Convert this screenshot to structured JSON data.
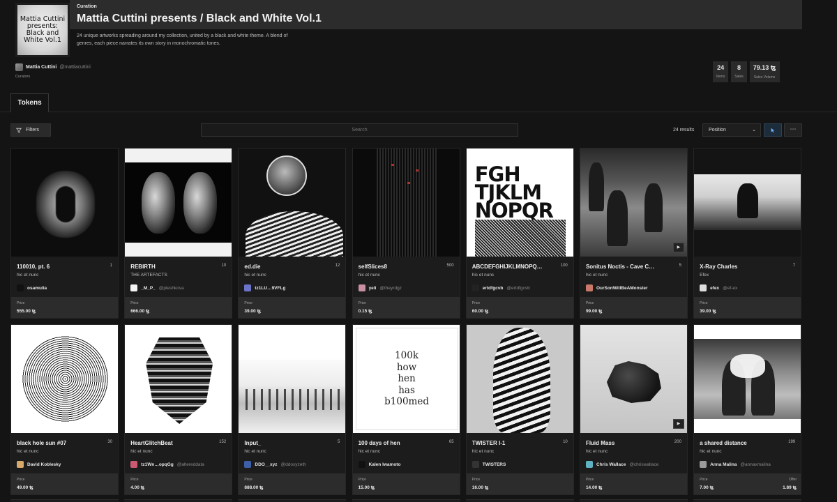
{
  "collection": {
    "eyebrow": "Curation",
    "title": "Mattia Cuttini presents / Black and White Vol.1",
    "description": "24 unique artworks spreading around my collection, united by a black and white theme.  A blend of genres, each piece narrates its own story in monochromatic tones.",
    "cover_text": "Mattia Cuttini\npresents:\nBlack and\nWhite Vol.1"
  },
  "curator": {
    "name": "Mattia Cuttini",
    "handle": "@mattiacuttini",
    "role_label": "Curators"
  },
  "stats": [
    {
      "value": "24",
      "label": "Items"
    },
    {
      "value": "8",
      "label": "Sales"
    },
    {
      "value": "79.13 ꜩ",
      "label": "Sales Volume"
    }
  ],
  "tabs": {
    "tokens": "Tokens"
  },
  "toolbar": {
    "filters_label": "Filters",
    "search_placeholder": "Search",
    "results_text": "24 results",
    "sort_value": "Position",
    "more_label": "⋯"
  },
  "price_label": "Price",
  "tokens": [
    {
      "title": "110010, pt. 6",
      "editions": "1",
      "platform": "hic et nunc",
      "artist": "osamulia",
      "handle": "",
      "avatar_color": "#111111",
      "price": "555.00 ꜩ"
    },
    {
      "title": "REBIRTH",
      "editions": "10",
      "platform": "THE ARTEFACTS",
      "artist": "_M_P_",
      "handle": "@pleshkova",
      "avatar_color": "#f2f2f2",
      "price": "666.00 ꜩ"
    },
    {
      "title": "ed.die",
      "editions": "12",
      "platform": "hic et nunc",
      "artist": "tz1LU…9VFLg",
      "handle": "",
      "avatar_color": "#6b74c9",
      "price": "39.00 ꜩ"
    },
    {
      "title": "selfSlices8",
      "editions": "500",
      "platform": "hic et nunc",
      "artist": "yeli",
      "handle": "@theyrdgz",
      "avatar_color": "#c98fa0",
      "price": "0.15 ꜩ"
    },
    {
      "title": "ABCDEFGHIJKLMNOPQ…",
      "editions": "100",
      "platform": "hic et nunc",
      "artist": "ertdfgcvb",
      "handle": "@ertdfgcvb",
      "avatar_color": "#222222",
      "price": "60.00 ꜩ"
    },
    {
      "title": "Sonitus Noctis - Cave C…",
      "editions": "5",
      "platform": "hic et nunc",
      "artist": "OurSonWillBeAMonster",
      "handle": "",
      "avatar_color": "#c9786a",
      "price": "99.00 ꜩ"
    },
    {
      "title": "X-Ray Charles",
      "editions": "7",
      "platform": "Efex",
      "artist": "efex",
      "handle": "@ef-ex",
      "avatar_color": "#dddddd",
      "price": "39.00 ꜩ"
    },
    {
      "title": "black hole sun #07",
      "editions": "30",
      "platform": "hic et nunc",
      "artist": "David Koblesky",
      "handle": "",
      "avatar_color": "#d6a86c",
      "price": "49.00 ꜩ"
    },
    {
      "title": "HeartGlitchBeat",
      "editions": "152",
      "platform": "hic et nunc",
      "artist": "tz1Wn…opqGg",
      "handle": "@altereddata",
      "avatar_color": "#c95a72",
      "price": "4.00 ꜩ"
    },
    {
      "title": "Input_",
      "editions": "5",
      "platform": "hic et nunc",
      "artist": "DDO__xyz",
      "handle": "@ddoxyzeth",
      "avatar_color": "#3d5fa8",
      "price": "888.00 ꜩ"
    },
    {
      "title": "100 days of hen",
      "editions": "65",
      "platform": "hic et nunc",
      "artist": "Kalen Iwamoto",
      "handle": "",
      "avatar_color": "#111111",
      "price": "15.00 ꜩ"
    },
    {
      "title": "TWISTER I-1",
      "editions": "10",
      "platform": "hic et nunc",
      "artist": "TWISTERS",
      "handle": "",
      "avatar_color": "#333333",
      "price": "16.00 ꜩ"
    },
    {
      "title": "Fluid Mass",
      "editions": "200",
      "platform": "hic et nunc",
      "artist": "Chris Wallace",
      "handle": "@chriswallace",
      "avatar_color": "#5fb1c4",
      "price": "14.00 ꜩ"
    },
    {
      "title": "a shared distance",
      "editions": "199",
      "platform": "hic et nunc",
      "artist": "Anna Malina",
      "handle": "@annaxmalina",
      "avatar_color": "#9a9a9a",
      "price": "7.00 ꜩ",
      "offer_label": "Offer",
      "offer": "1.89 ꜩ"
    }
  ],
  "artwork_text": {
    "abc": "FGH\nTJKLM\nNOPQR",
    "hen": "100k\nhow\nhen\nhas\nb100med"
  },
  "play_icon": "▶"
}
